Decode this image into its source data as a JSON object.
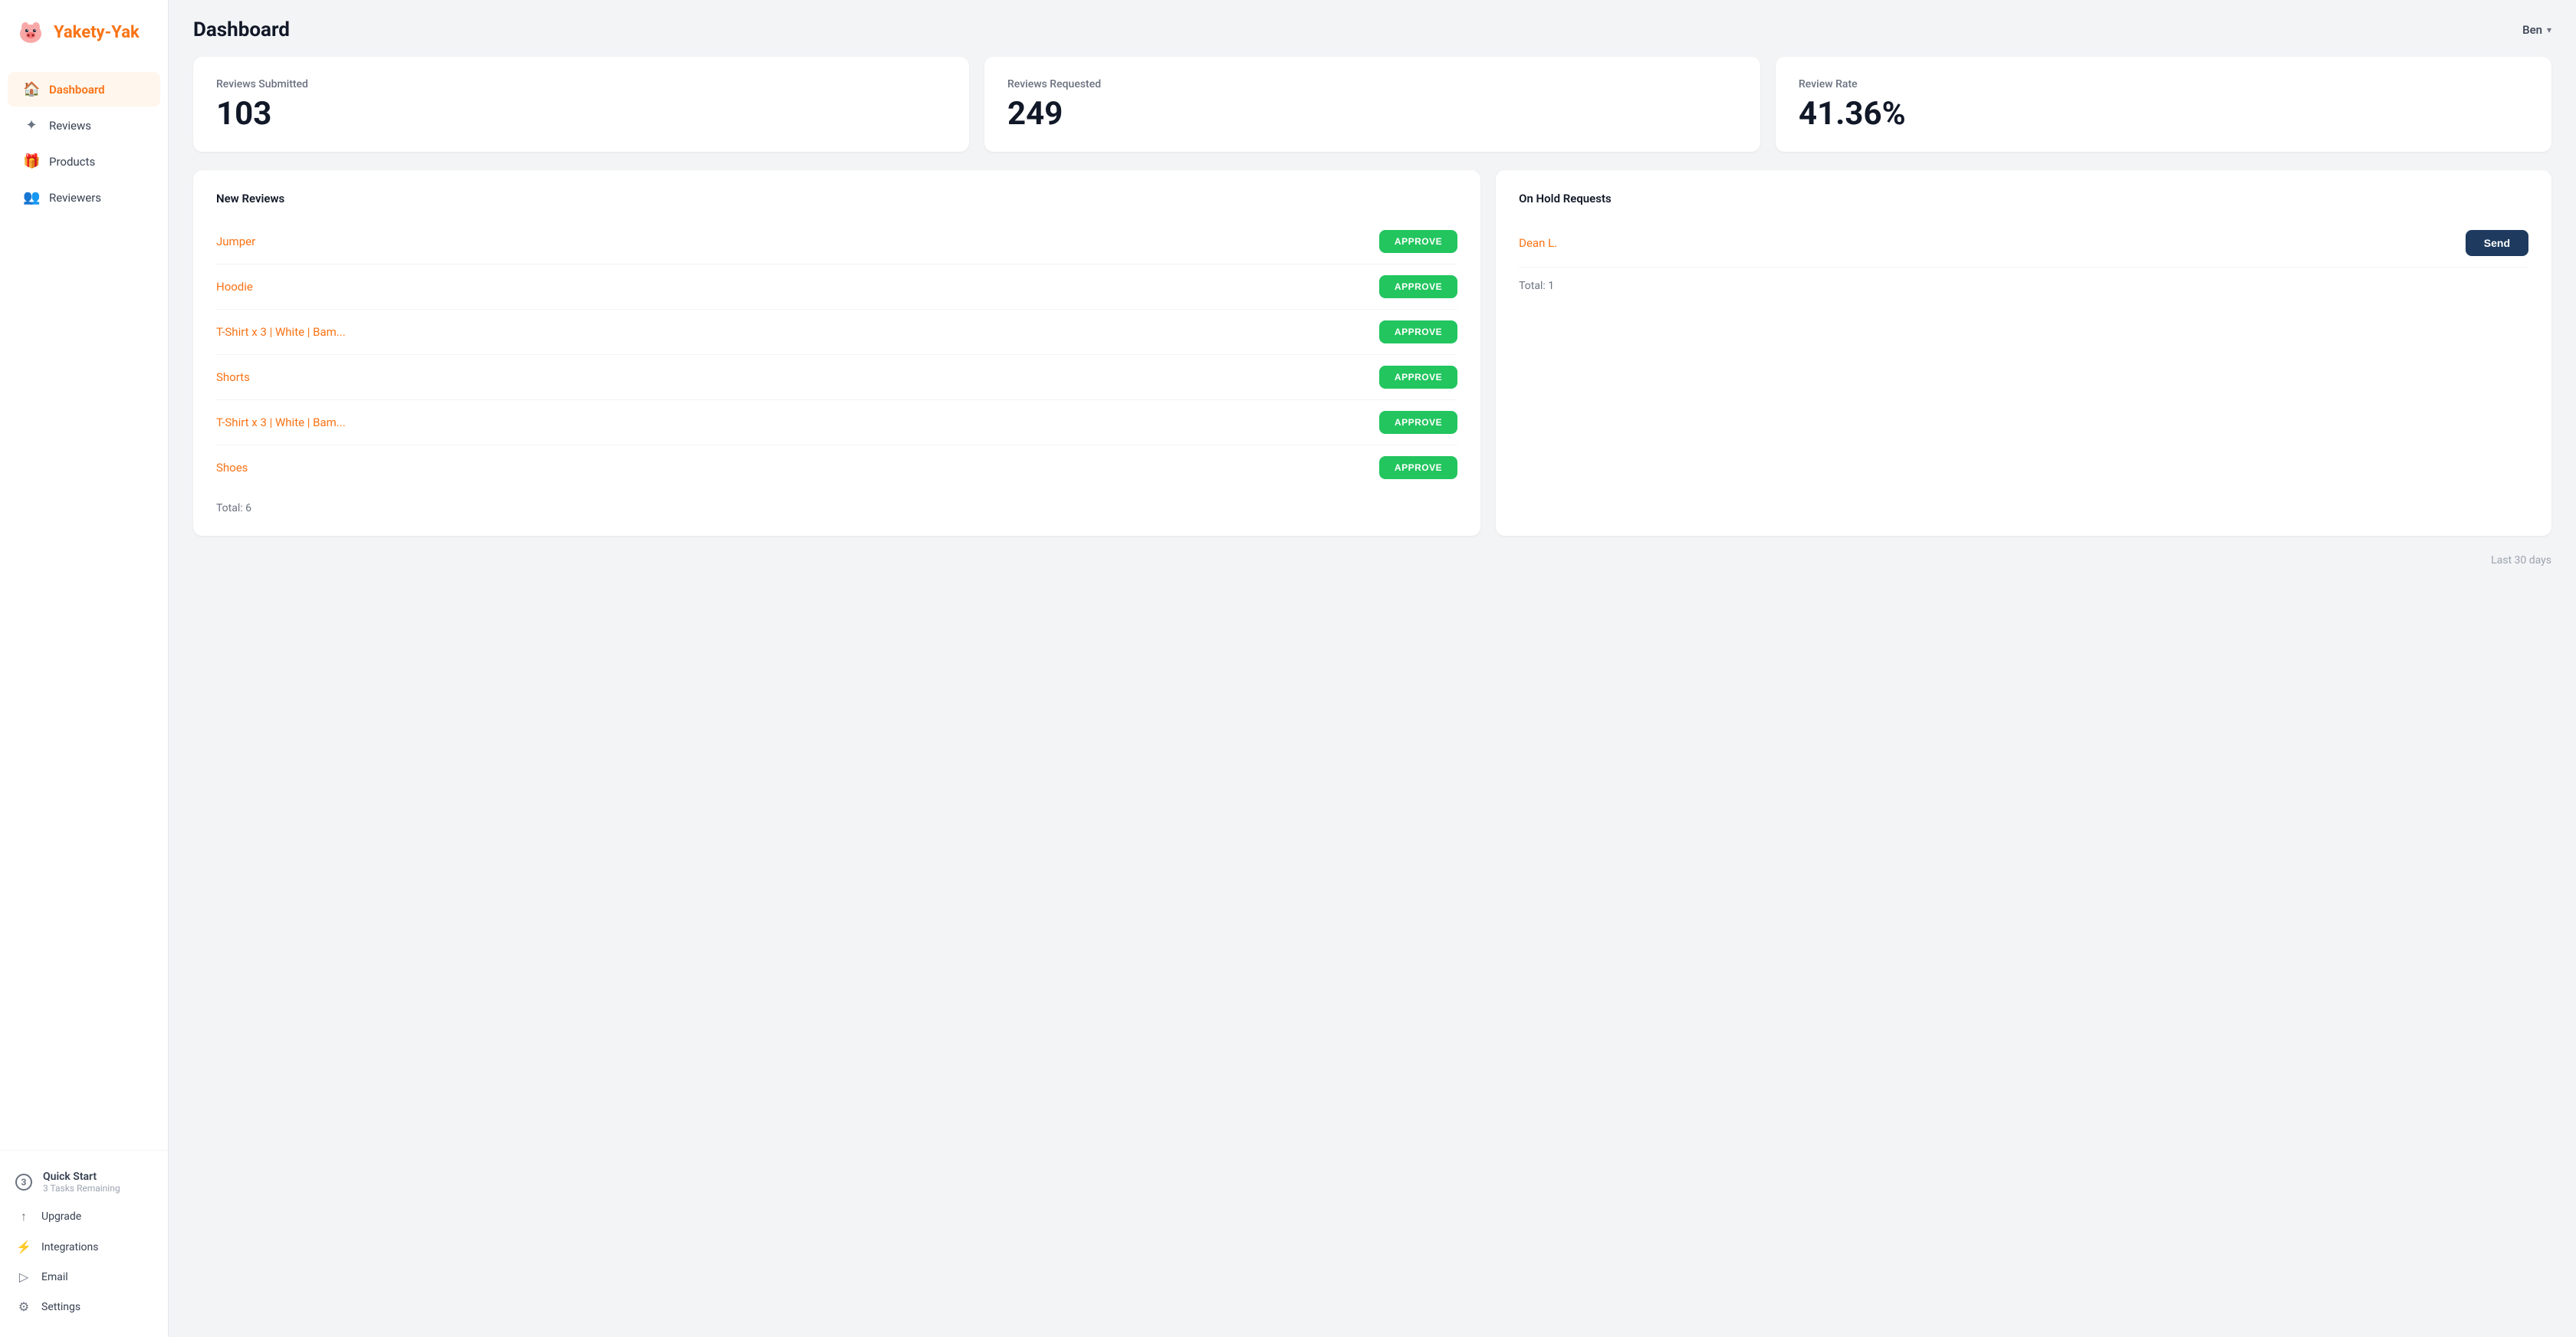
{
  "app": {
    "name": "Yakety-Yak"
  },
  "header": {
    "title": "Dashboard",
    "user": "Ben"
  },
  "sidebar": {
    "nav_items": [
      {
        "id": "dashboard",
        "label": "Dashboard",
        "icon": "🏠",
        "active": true
      },
      {
        "id": "reviews",
        "label": "Reviews",
        "icon": "✦",
        "active": false
      },
      {
        "id": "products",
        "label": "Products",
        "icon": "🎁",
        "active": false
      },
      {
        "id": "reviewers",
        "label": "Reviewers",
        "icon": "👥",
        "active": false
      }
    ],
    "bottom_items": [
      {
        "id": "upgrade",
        "label": "Upgrade",
        "icon": "↑"
      },
      {
        "id": "integrations",
        "label": "Integrations",
        "icon": "⚡"
      },
      {
        "id": "email",
        "label": "Email",
        "icon": "▷"
      },
      {
        "id": "settings",
        "label": "Settings",
        "icon": "⚙"
      }
    ],
    "quick_start": {
      "badge": "3",
      "title": "Quick Start",
      "sub": "3 Tasks Remaining"
    }
  },
  "stats": [
    {
      "id": "reviews-submitted",
      "label": "Reviews Submitted",
      "value": "103"
    },
    {
      "id": "reviews-requested",
      "label": "Reviews Requested",
      "value": "249"
    },
    {
      "id": "review-rate",
      "label": "Review Rate",
      "value": "41.36%"
    }
  ],
  "new_reviews": {
    "title": "New Reviews",
    "items": [
      {
        "id": "jumper",
        "name": "Jumper",
        "btn_label": "APPROVE"
      },
      {
        "id": "hoodie",
        "name": "Hoodie",
        "btn_label": "APPROVE"
      },
      {
        "id": "tshirt1",
        "name": "T-Shirt x 3 | White | Bam...",
        "btn_label": "APPROVE"
      },
      {
        "id": "shorts",
        "name": "Shorts",
        "btn_label": "APPROVE"
      },
      {
        "id": "tshirt2",
        "name": "T-Shirt x 3 | White | Bam...",
        "btn_label": "APPROVE"
      },
      {
        "id": "shoes",
        "name": "Shoes",
        "btn_label": "APPROVE"
      }
    ],
    "total": "Total: 6"
  },
  "on_hold": {
    "title": "On Hold Requests",
    "items": [
      {
        "id": "dean",
        "name": "Dean L.",
        "btn_label": "Send"
      }
    ],
    "total": "Total: 1"
  },
  "last_days": "Last 30 days"
}
